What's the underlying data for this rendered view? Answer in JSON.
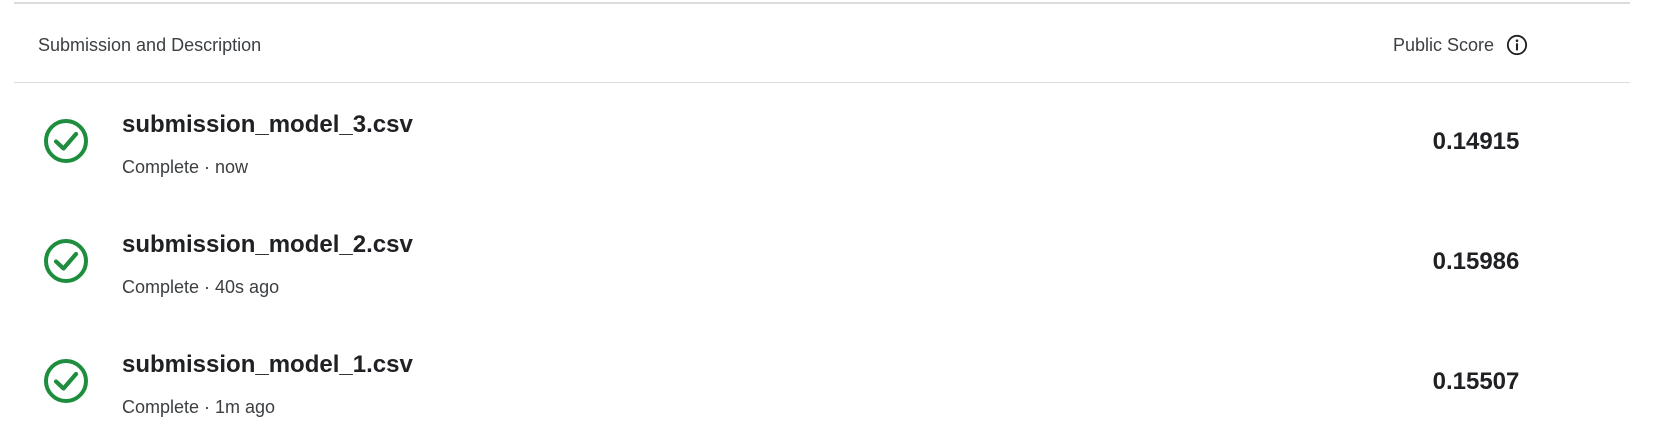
{
  "header": {
    "description_label": "Submission and Description",
    "score_label": "Public Score",
    "info_icon": "info-icon"
  },
  "colors": {
    "success": "#1e8e3e",
    "divider": "#dadce0"
  },
  "submissions": [
    {
      "file_name": "submission_model_3.csv",
      "status": "Complete · now",
      "public_score": "0.14915",
      "icon": "check-circle-icon"
    },
    {
      "file_name": "submission_model_2.csv",
      "status": "Complete · 40s ago",
      "public_score": "0.15986",
      "icon": "check-circle-icon"
    },
    {
      "file_name": "submission_model_1.csv",
      "status": "Complete · 1m ago",
      "public_score": "0.15507",
      "icon": "check-circle-icon"
    }
  ]
}
